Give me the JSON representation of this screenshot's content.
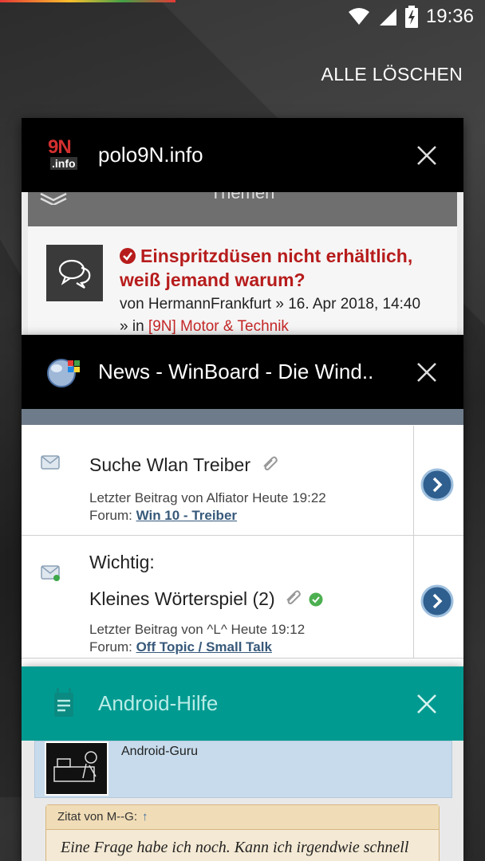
{
  "status_bar": {
    "time": "19:36",
    "icons": [
      "wifi-icon",
      "signal-icon",
      "battery-charging-icon"
    ]
  },
  "recents": {
    "clear_all_label": "ALLE LÖSCHEN"
  },
  "cards": [
    {
      "app_title": "polo9N.info",
      "icon": "polo9n-logo",
      "icon_text_top": "9N",
      "icon_text_bottom": ".info",
      "header_color": "#000000",
      "content": {
        "band_label": "Themen",
        "topic_title": "Einspritzdüsen nicht erhältlich, weiß jemand warum?",
        "meta_line": "von HermannFrankfurt » 16. Apr 2018, 14:40",
        "in_prefix": "» in",
        "forum_link": "[9N] Motor & Technik"
      }
    },
    {
      "app_title": "News - WinBoard - Die Wind..",
      "icon": "winboard-globe-icon",
      "header_color": "#000000",
      "content": {
        "threads": [
          {
            "title": "Suche Wlan Treiber",
            "last_post": "Letzter Beitrag von Alfiator Heute 19:22",
            "forum_prefix": "Forum:",
            "forum": "Win 10 - Treiber"
          },
          {
            "prefix": "Wichtig:",
            "title": "Kleines Wörterspiel (2)",
            "last_post": "Letzter Beitrag von ^L^ Heute 19:12",
            "forum_prefix": "Forum:",
            "forum": "Off Topic / Small Talk"
          }
        ]
      }
    },
    {
      "app_title": "Android-Hilfe",
      "icon": "android-hilfe-icon",
      "header_color": "#009a91",
      "content": {
        "user_role": "Android-Guru",
        "quote_header": "Zitat von M--G:",
        "quote_arrow": "↑",
        "quote_text": "Eine Frage habe ich noch. Kann ich irgendwie schnell"
      }
    }
  ]
}
